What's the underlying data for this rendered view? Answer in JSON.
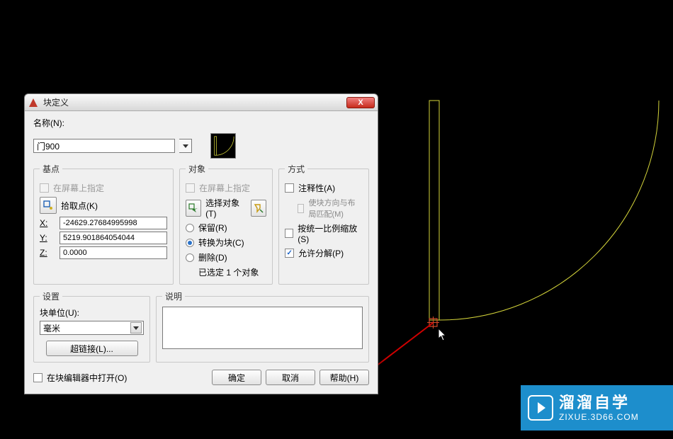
{
  "dialog": {
    "title": "块定义",
    "name_label": "名称(N):",
    "name_value": "门900",
    "basepoint": {
      "legend": "基点",
      "specify_onscreen": "在屏幕上指定",
      "pick_point": "拾取点(K)",
      "x_label": "X:",
      "x_value": "-24629.27684995998",
      "y_label": "Y:",
      "y_value": "5219.901864054044",
      "z_label": "Z:",
      "z_value": "0.0000"
    },
    "object": {
      "legend": "对象",
      "specify_onscreen": "在屏幕上指定",
      "select_objects": "选择对象(T)",
      "retain": "保留(R)",
      "convert": "转换为块(C)",
      "delete": "删除(D)",
      "selected_note": "已选定 1 个对象"
    },
    "mode": {
      "legend": "方式",
      "annotative": "注释性(A)",
      "match_orient": "使块方向与布局匹配(M)",
      "uniform_scale": "按统一比例缩放(S)",
      "allow_explode": "允许分解(P)"
    },
    "settings": {
      "legend": "设置",
      "block_unit_label": "块单位(U):",
      "block_unit_value": "毫米",
      "hyperlink": "超链接(L)..."
    },
    "description": {
      "legend": "说明",
      "value": ""
    },
    "open_in_editor": "在块编辑器中打开(O)",
    "ok": "确定",
    "cancel": "取消",
    "help": "帮助(H)"
  },
  "callout": {
    "label": "基点"
  },
  "watermark": {
    "line1": "溜溜自学",
    "line2": "ZIXUE.3D66.COM"
  }
}
